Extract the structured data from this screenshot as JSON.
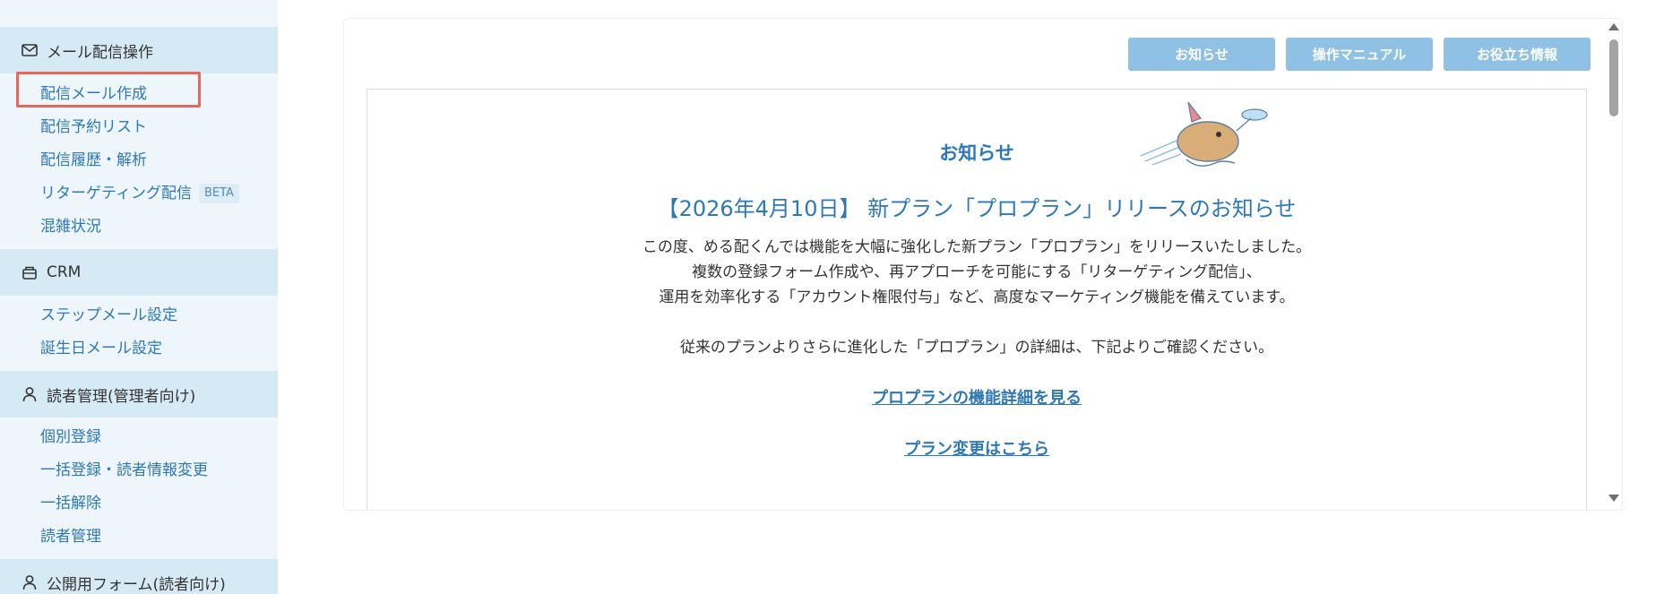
{
  "sidebar": {
    "sections": [
      {
        "icon": "mail-icon",
        "label": "メール配信操作"
      },
      {
        "icon": "crm-icon",
        "label": "CRM"
      },
      {
        "icon": "person-icon",
        "label": "読者管理(管理者向け)"
      },
      {
        "icon": "person-icon",
        "label": "公開用フォーム(読者向け)"
      }
    ],
    "links": {
      "compose": "配信メール作成",
      "schedule": "配信予約リスト",
      "history": "配信履歴・解析",
      "retargeting": "リターゲティング配信",
      "retargeting_badge": "BETA",
      "congestion": "混雑状況",
      "step_mail": "ステップメール設定",
      "birthday_mail": "誕生日メール設定",
      "individual_register": "個別登録",
      "bulk_register": "一括登録・読者情報変更",
      "bulk_cancel": "一括解除",
      "reader_manage": "読者管理"
    }
  },
  "toolbar": {
    "notice": "お知らせ",
    "manual": "操作マニュアル",
    "tips": "お役立ち情報"
  },
  "notice": {
    "heading": "お知らせ",
    "title": "【2026年4月10日】 新プラン「プロプラン」リリースのお知らせ",
    "lines": [
      "この度、める配くんでは機能を大幅に強化した新プラン「プロプラン」をリリースいたしました。",
      "複数の登録フォーム作成や、再アプローチを可能にする「リターゲティング配信」、",
      "運用を効率化する「アカウント権限付与」など、高度なマーケティング機能を備えています。",
      "",
      "従来のプランよりさらに進化した「プロプラン」の詳細は、下記よりご確認ください。"
    ],
    "link_details": "プロプランの機能詳細を見る",
    "link_change": "プラン変更はこちら"
  },
  "colors": {
    "accent": "#2e78b5",
    "button": "#8ec1e4",
    "sidebar_bg": "#eef6fb",
    "section_bg": "#d6eaf5",
    "highlight": "#e8675a"
  }
}
